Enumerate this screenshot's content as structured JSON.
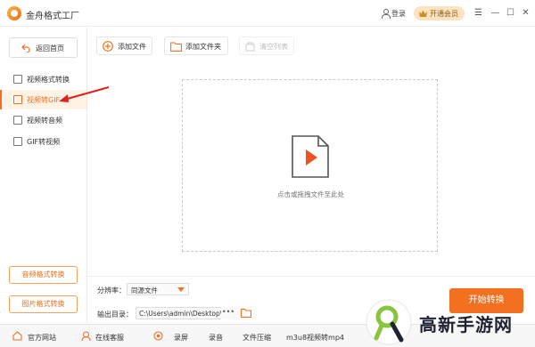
{
  "app": {
    "title": "金舟格式工厂"
  },
  "header": {
    "login_label": "登录",
    "vip_label": "开通会员"
  },
  "sidebar": {
    "back_label": "返回首页",
    "items": [
      {
        "label": "视频格式转换"
      },
      {
        "label": "视频转GIF"
      },
      {
        "label": "视频转音频"
      },
      {
        "label": "GIF转视频"
      }
    ],
    "bottom_buttons": [
      {
        "label": "音频格式转换"
      },
      {
        "label": "图片格式转换"
      }
    ]
  },
  "toolbar": {
    "add_file": "添加文件",
    "add_folder": "添加文件夹",
    "clear_list": "清空列表"
  },
  "dropzone": {
    "hint": "点击或拖拽文件至此处"
  },
  "settings": {
    "resolution_label": "分辨率：",
    "resolution_value": "同源文件",
    "output_label": "输出目录：",
    "output_path": "C:\\Users\\admin\\Desktop\\",
    "more": "•••"
  },
  "actions": {
    "start_label": "开始转换"
  },
  "statusbar": {
    "items": [
      {
        "label": "官方网站"
      },
      {
        "label": "在线客服"
      },
      {
        "label": "录屏"
      },
      {
        "label": "录音"
      },
      {
        "label": "文件压缩"
      },
      {
        "label": "m3u8视频转mp4"
      }
    ]
  },
  "watermark": {
    "text": "高新手游网"
  },
  "colors": {
    "accent": "#f2701f",
    "vip_bg": "#fde3bf"
  }
}
